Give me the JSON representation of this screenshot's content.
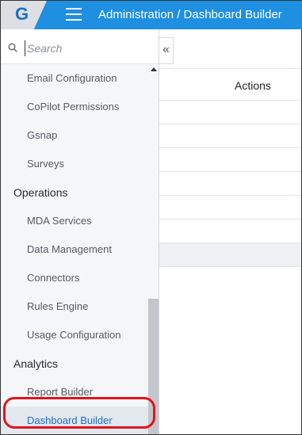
{
  "header": {
    "logo_letter": "G",
    "title": "Administration / Dashboard Builder"
  },
  "search": {
    "placeholder": "Search",
    "value": ""
  },
  "sidebar": {
    "items": [
      {
        "label": "Email Configuration",
        "kind": "item"
      },
      {
        "label": "CoPilot Permissions",
        "kind": "item"
      },
      {
        "label": "Gsnap",
        "kind": "item"
      },
      {
        "label": "Surveys",
        "kind": "item"
      },
      {
        "label": "Operations",
        "kind": "section"
      },
      {
        "label": "MDA Services",
        "kind": "item"
      },
      {
        "label": "Data Management",
        "kind": "item"
      },
      {
        "label": "Connectors",
        "kind": "item"
      },
      {
        "label": "Rules Engine",
        "kind": "item"
      },
      {
        "label": "Usage Configuration",
        "kind": "item"
      },
      {
        "label": "Analytics",
        "kind": "section"
      },
      {
        "label": "Report Builder",
        "kind": "item"
      },
      {
        "label": "Dashboard Builder",
        "kind": "item",
        "active": true
      }
    ]
  },
  "main": {
    "collapse_glyph": "«",
    "actions_header": "Actions"
  },
  "colors": {
    "topbar": "#1e8fe1",
    "active_text": "#1e6fc2",
    "highlight": "#e0141e"
  },
  "icons": {
    "hamburger": "menu-icon",
    "search": "search-icon",
    "collapse": "double-chevron-left-icon",
    "scroll_up": "caret-up-icon"
  }
}
